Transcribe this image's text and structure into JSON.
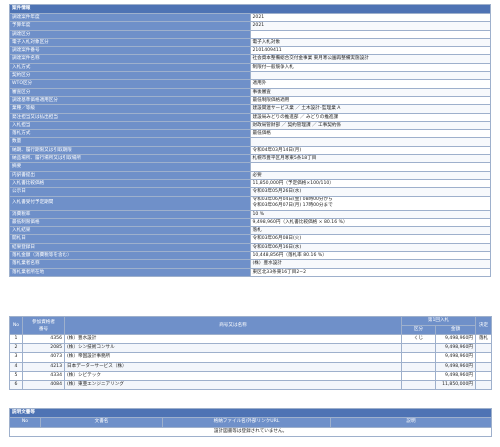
{
  "case_info": {
    "title": "案件情報",
    "rows": [
      {
        "label": "調達案件年度",
        "value": "2021"
      },
      {
        "label": "予算年度",
        "value": "2021"
      },
      {
        "label": "調達区分",
        "value": ""
      },
      {
        "label": "電子入札対象区分",
        "value": "電子入札対象"
      },
      {
        "label": "調達案件番号",
        "value": "2101409411"
      },
      {
        "label": "調達案件名称",
        "value": "社会資本整備総合交付金事業 東月寒公園再整備実施設計"
      },
      {
        "label": "入札方式",
        "value": "制限付一般競争入札"
      },
      {
        "label": "契約区分",
        "value": ""
      },
      {
        "label": "WTO区分",
        "value": "適用外"
      },
      {
        "label": "審査区分",
        "value": "事後審査"
      },
      {
        "label": "調達基準価格適用区分",
        "value": "最低制限価格適用"
      },
      {
        "label": "業種／等級",
        "value": "建設関連サービス業 ／ 土木設計･監理業 A"
      },
      {
        "label": "発注担当又は払出担当",
        "value": "建設局みどりの推進部 ／ みどりの推進課"
      },
      {
        "label": "入札担当",
        "value": "財政局管財部 ／ 契約管理課 ／ 工事契約係"
      },
      {
        "label": "落札方式",
        "value": "最低価格"
      },
      {
        "label": "数量",
        "value": ""
      },
      {
        "label": "納期、履行期限又は引取期限",
        "value": "令和04年03月14日(月)"
      },
      {
        "label": "納品場所、履行場所又は引取場所",
        "value": "札幌市豊平区月寒東5条18丁目"
      },
      {
        "label": "摘要",
        "value": ""
      },
      {
        "label": "内訳書提出",
        "value": "必要"
      },
      {
        "label": "入札書比較価格",
        "value": "11,850,000円（予定価格×100/110）"
      },
      {
        "label": "公示日",
        "value": "令和03年05月26日(水)"
      },
      {
        "label": "入札書受付予定期間",
        "value": "令和03年06月04日(金) 08時00分から\n令和03年06月07日(月) 17時00分まで"
      },
      {
        "label": "消費税率",
        "value": "10 %"
      },
      {
        "label": "最低制限価格",
        "value": "9,498,960円（入札書比較価格 × 80.16 %）"
      },
      {
        "label": "入札結果",
        "value": "落札"
      },
      {
        "label": "開札日",
        "value": "令和03年06月08日(火)"
      },
      {
        "label": "結果登録日",
        "value": "令和03年06月16日(水)"
      },
      {
        "label": "落札金額（消費税等を含む）",
        "value": "10,448,856円（落札率 80.16 %）"
      },
      {
        "label": "落札業者名称",
        "value": "(株）豊水設計"
      },
      {
        "label": "落札業者所在地",
        "value": "東区北33条東16丁目2−2"
      }
    ]
  },
  "bid_table": {
    "headers": {
      "no": "No",
      "reg": "参加資格者\n番号",
      "name": "商号又は名称",
      "round1": "第1回入札",
      "kubun": "区分",
      "amount": "金額",
      "decision": "決定"
    },
    "rows": [
      {
        "no": "1",
        "reg": "4356",
        "name": "(株）豊水設計",
        "kubun": "くじ",
        "amount": "9,498,960円",
        "decision": "落札"
      },
      {
        "no": "2",
        "reg": "2085",
        "name": "(株）シン技術コンサル",
        "kubun": "",
        "amount": "9,498,960円",
        "decision": ""
      },
      {
        "no": "3",
        "reg": "4073",
        "name": "(株）帝国設計事務所",
        "kubun": "",
        "amount": "9,498,960円",
        "decision": ""
      },
      {
        "no": "4",
        "reg": "4213",
        "name": "日本データーサービス（株）",
        "kubun": "",
        "amount": "9,498,960円",
        "decision": ""
      },
      {
        "no": "5",
        "reg": "4334",
        "name": "(株）シビテック",
        "kubun": "",
        "amount": "9,498,960円",
        "decision": ""
      },
      {
        "no": "6",
        "reg": "4084",
        "name": "(株）東亜エンジニアリング",
        "kubun": "",
        "amount": "11,850,000円",
        "decision": ""
      }
    ]
  },
  "docs": {
    "title": "説明文書等",
    "headers": {
      "no": "No",
      "doc": "文書名",
      "file": "格納ファイル名/外部リンクURL",
      "desc": "説明"
    },
    "message": "設計図書等は登録されていません。"
  }
}
